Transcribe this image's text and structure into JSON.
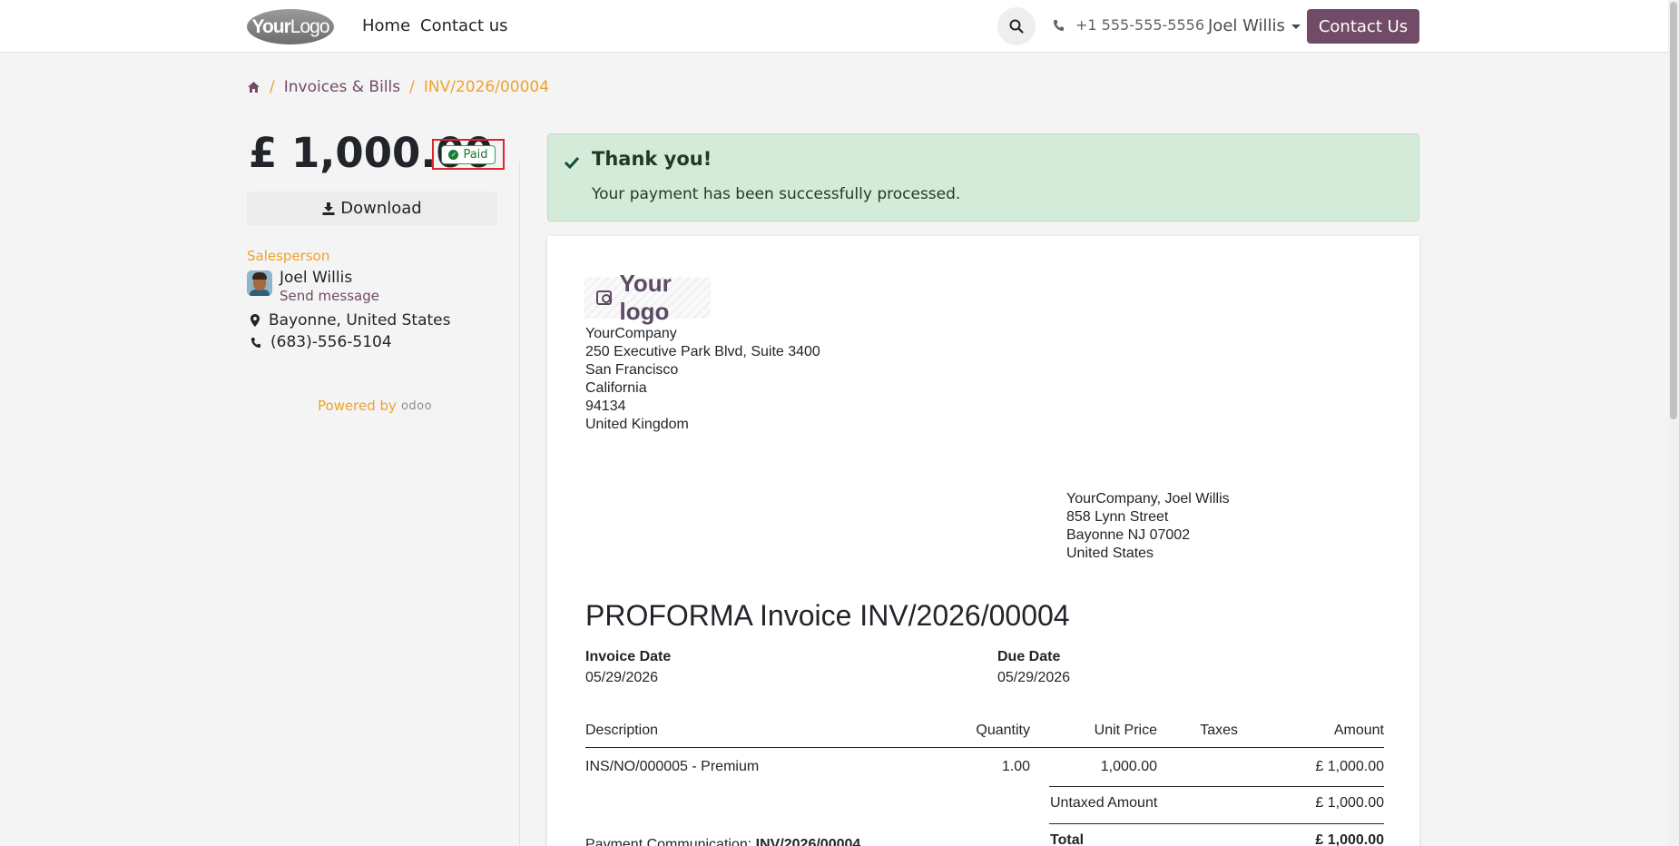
{
  "header": {
    "logo_text_bold": "Your",
    "logo_text_light": "Logo",
    "nav": [
      "Home",
      "Contact us"
    ],
    "phone": "+1 555-555-5556",
    "user": "Joel Willis",
    "contact_button": "Contact Us"
  },
  "breadcrumb": {
    "sep": "/",
    "items": [
      "Invoices & Bills",
      "INV/2026/00004"
    ]
  },
  "sidebar": {
    "amount": "£ 1,000.00",
    "status": "Paid",
    "download": "Download",
    "salesperson_label": "Salesperson",
    "salesperson_name": "Joel Willis",
    "send_message": "Send message",
    "location": "Bayonne, United States",
    "phone": "(683)-556-5104",
    "powered_by": "Powered by",
    "powered_brand": "odoo"
  },
  "alert": {
    "title": "Thank you!",
    "message": "Your payment has been successfully processed."
  },
  "invoice": {
    "logo_text": "Your logo",
    "company_address": [
      "YourCompany",
      "250 Executive Park Blvd, Suite 3400",
      "San Francisco",
      "California",
      "94134",
      "United Kingdom"
    ],
    "customer_address": [
      "YourCompany, Joel Willis",
      "858 Lynn Street",
      "Bayonne NJ 07002",
      "United States"
    ],
    "title": "PROFORMA Invoice INV/2026/00004",
    "invoice_date_label": "Invoice Date",
    "invoice_date": "05/29/2026",
    "due_date_label": "Due Date",
    "due_date": "05/29/2026",
    "columns": [
      "Description",
      "Quantity",
      "Unit Price",
      "Taxes",
      "Amount"
    ],
    "lines": [
      {
        "description": "INS/NO/000005 - Premium",
        "quantity": "1.00",
        "unit_price": "1,000.00",
        "taxes": "",
        "amount": "£ 1,000.00"
      }
    ],
    "untaxed_label": "Untaxed Amount",
    "untaxed_value": "£ 1,000.00",
    "total_label": "Total",
    "total_value": "£ 1,000.00",
    "payment_comm_label": "Payment Communication:",
    "payment_comm_value": "INV/2026/00004"
  },
  "colors": {
    "brand": "#714b67",
    "accent": "#f0a22b",
    "success_bg": "#d4ebd9",
    "paid_green": "#28a745"
  }
}
